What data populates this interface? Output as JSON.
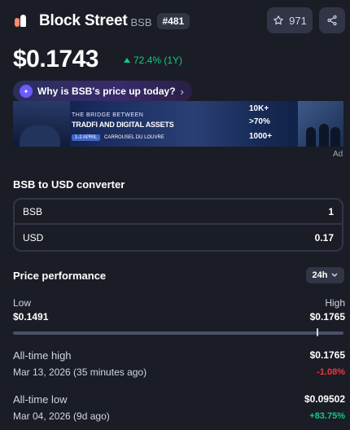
{
  "coin": {
    "name": "Block Street",
    "symbol": "BSB",
    "rank": "#481",
    "watchlist_count": "971",
    "price": "$0.1743",
    "change_1y": "72.4% (1Y)",
    "why_label": "Why is BSB's price up today?",
    "colors": {
      "positive": "#16c784",
      "negative": "#ea3943",
      "background": "#1a1d26",
      "card": "#323546"
    }
  },
  "ad": {
    "tag": "Ad",
    "headline_small": "THE BRIDGE BETWEEN",
    "headline": "TRADFI AND DIGITAL ASSETS",
    "date_pill": "1-2 APRIL",
    "venue": "CARROUSEL DU LOUVRE",
    "stat1": "10K+",
    "stat2": ">70%",
    "stat3": "1000+"
  },
  "converter": {
    "title": "BSB to USD converter",
    "rows": [
      {
        "label": "BSB",
        "value": "1"
      },
      {
        "label": "USD",
        "value": "0.17"
      }
    ]
  },
  "performance": {
    "title": "Price performance",
    "timeframe": "24h",
    "low_label": "Low",
    "high_label": "High",
    "low_value": "$0.1491",
    "high_value": "$0.1765",
    "range_position": 0.92,
    "ath_label": "All-time high",
    "ath_value": "$0.1765",
    "ath_date": "Mar 13, 2026 (35 minutes ago)",
    "ath_change": "-1.08%",
    "atl_label": "All-time low",
    "atl_value": "$0.09502",
    "atl_date": "Mar 04, 2026 (9d ago)",
    "atl_change": "+83.75%"
  }
}
